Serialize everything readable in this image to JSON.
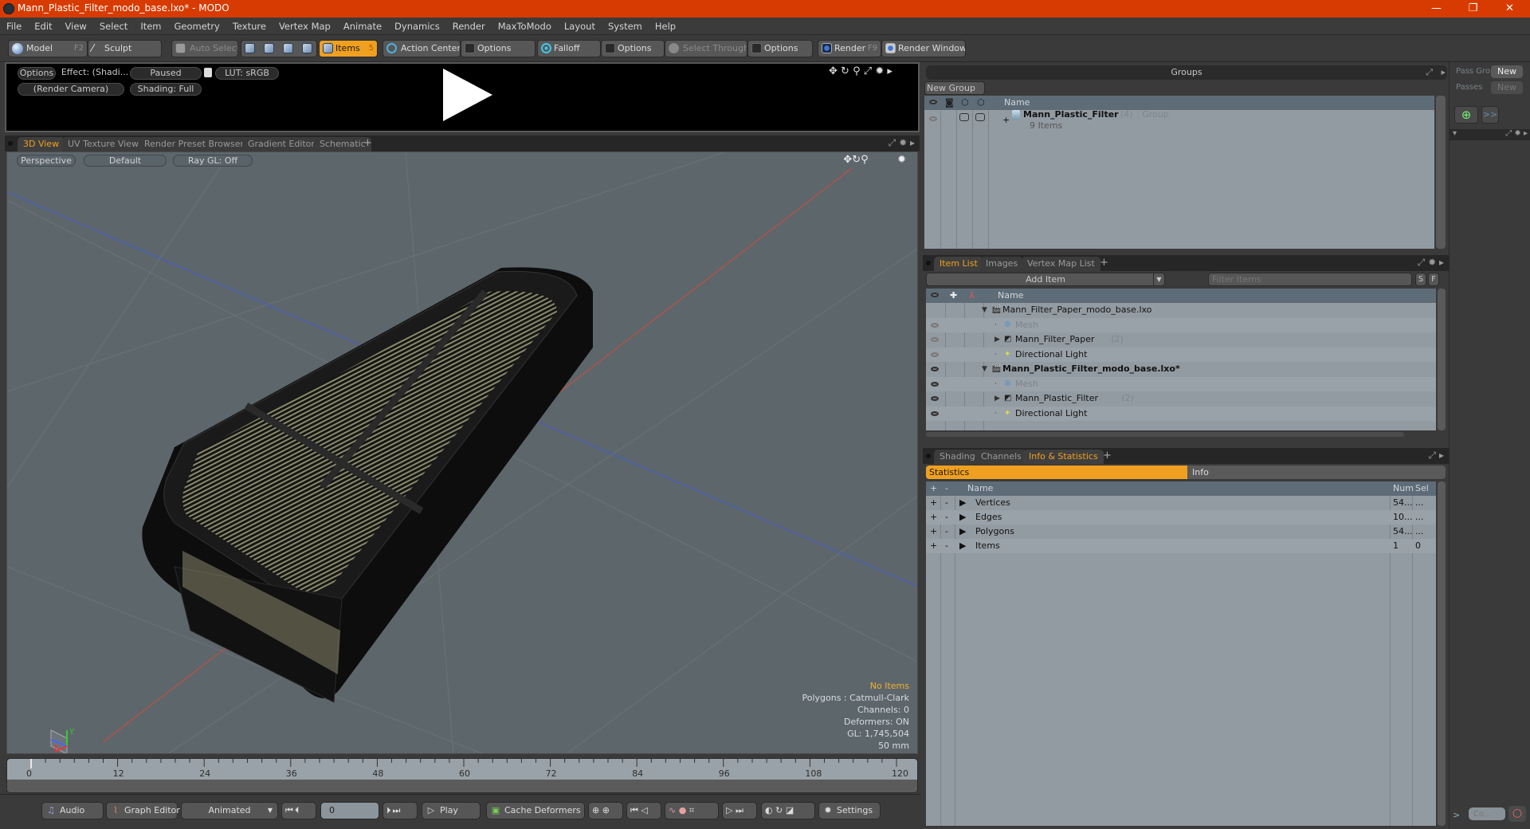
{
  "window": {
    "title": "Mann_Plastic_Filter_modo_base.lxo* - MODO",
    "controls": [
      "—",
      "❐",
      "✕"
    ]
  },
  "menu": [
    "File",
    "Edit",
    "View",
    "Select",
    "Item",
    "Geometry",
    "Texture",
    "Vertex Map",
    "Animate",
    "Dynamics",
    "Render",
    "MaxToModo",
    "Layout",
    "System",
    "Help"
  ],
  "toolbar": {
    "model": "Model",
    "model_shortcut": "F2",
    "sculpt": "Sculpt",
    "auto_select": "Auto Select",
    "items": "Items",
    "items_shortcut": "5",
    "action_center": "Action Center",
    "options1": "Options",
    "falloff": "Falloff",
    "options2": "Options",
    "select_through": "Select Through",
    "options3": "Options",
    "render": "Render",
    "render_shortcut": "F9",
    "render_window": "Render Window"
  },
  "render_preview": {
    "options": "Options",
    "effect": "Effect: (Shadi...",
    "paused": "Paused",
    "lut": "LUT: sRGB",
    "camera": "(Render Camera)",
    "shading": "Shading: Full"
  },
  "viewport_tabs": [
    {
      "label": "3D View",
      "active": true
    },
    {
      "label": "UV Texture View",
      "active": false
    },
    {
      "label": "Render Preset Browser",
      "active": false
    },
    {
      "label": "Gradient Editor",
      "active": false
    },
    {
      "label": "Schematic",
      "active": false
    }
  ],
  "viewport": {
    "projection": "Perspective",
    "style": "Default",
    "raygl": "Ray GL: Off",
    "overlay": {
      "selection": "No Items",
      "polygons": "Polygons : Catmull-Clark",
      "channels": "Channels: 0",
      "deformers": "Deformers: ON",
      "gl": "GL: 1,745,504",
      "focal": "50 mm"
    },
    "axes": {
      "x": "X",
      "y": "Y",
      "z": "Z"
    }
  },
  "timeline": {
    "ticks": [
      "0",
      "12",
      "24",
      "36",
      "48",
      "60",
      "72",
      "84",
      "96",
      "108",
      "120"
    ],
    "range_start": "0",
    "range_mid": "120",
    "range_end": "120",
    "current_frame": 0
  },
  "bottombar": {
    "audio": "Audio",
    "graph_editor": "Graph Editor",
    "animated": "Animated",
    "frame": "0",
    "play": "Play",
    "cache_deformers": "Cache Deformers",
    "settings": "Settings"
  },
  "groups": {
    "title": "Groups",
    "new_group": "New Group",
    "col_name": "Name",
    "row": {
      "name": "Mann_Plastic_Filter",
      "count": "(4)",
      "type": ": Group",
      "sub": "9 Items"
    }
  },
  "passes": {
    "pass_group_label": "Pass Gro",
    "pass_group_btn": "New",
    "passes_label": "Passes",
    "passes_btn": "New",
    "more": ">>",
    "command_placeholder": "Co...",
    "prompt": ">"
  },
  "item_list": {
    "tabs": [
      {
        "label": "Item List",
        "active": true
      },
      {
        "label": "Images",
        "active": false
      },
      {
        "label": "Vertex Map List",
        "active": false
      }
    ],
    "add_item": "Add Item",
    "filter_placeholder": "Filter Items",
    "s_btn": "S",
    "f_btn": "F",
    "col_name": "Name",
    "rows": [
      {
        "name": "Mann_Filter_Paper_modo_base.lxo",
        "kind": "scene",
        "level": 0,
        "bold": false,
        "eye": "none"
      },
      {
        "name": "Mesh",
        "kind": "mesh",
        "level": 1,
        "dim": true,
        "eye": "dim"
      },
      {
        "name": "Mann_Filter_Paper",
        "count": "(2)",
        "kind": "group",
        "level": 1,
        "eye": "dim"
      },
      {
        "name": "Directional Light",
        "kind": "light",
        "level": 1,
        "eye": "dim"
      },
      {
        "name": "Mann_Plastic_Filter_modo_base.lxo*",
        "kind": "scene",
        "level": 0,
        "bold": true,
        "eye": "on"
      },
      {
        "name": "Mesh",
        "kind": "mesh",
        "level": 1,
        "dim": true,
        "eye": "on"
      },
      {
        "name": "Mann_Plastic_Filter",
        "count": "(2)",
        "kind": "group",
        "level": 1,
        "eye": "on"
      },
      {
        "name": "Directional Light",
        "kind": "light",
        "level": 1,
        "eye": "on"
      }
    ]
  },
  "info_panel": {
    "tabs": [
      {
        "label": "Shading",
        "active": false
      },
      {
        "label": "Channels",
        "active": false
      },
      {
        "label": "Info & Statistics",
        "active": true
      }
    ],
    "subtabs": {
      "statistics": "Statistics",
      "info": "Info"
    },
    "columns": {
      "plus": "+",
      "minus": "-",
      "name": "Name",
      "num": "Num",
      "sel": "Sel"
    },
    "rows": [
      {
        "name": "Vertices",
        "num": "54...",
        "sel": "..."
      },
      {
        "name": "Edges",
        "num": "10...",
        "sel": "..."
      },
      {
        "name": "Polygons",
        "num": "54...",
        "sel": "..."
      },
      {
        "name": "Items",
        "num": "1",
        "sel": "0"
      }
    ]
  },
  "colors": {
    "titlebar": "#d83b01",
    "accent": "#f0a020",
    "viewport_bg": "#5d666b",
    "list_bg": "#939ba2"
  }
}
